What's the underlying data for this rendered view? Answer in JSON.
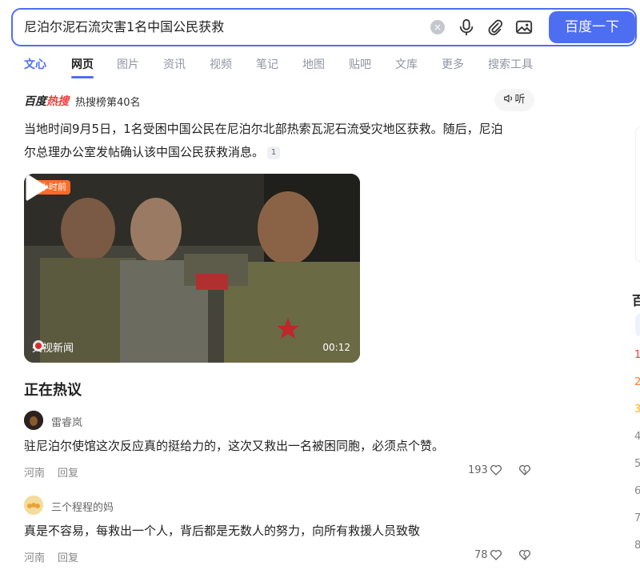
{
  "search": {
    "query": "尼泊尔泥石流灾害1名中国公民获救",
    "button_label": "百度一下",
    "clear_symbol": "×"
  },
  "tabs": [
    {
      "label": "文心"
    },
    {
      "label": "网页"
    },
    {
      "label": "图片"
    },
    {
      "label": "资讯"
    },
    {
      "label": "视频"
    },
    {
      "label": "笔记"
    },
    {
      "label": "地图"
    },
    {
      "label": "贴吧"
    },
    {
      "label": "文库"
    },
    {
      "label": "更多"
    },
    {
      "label": "搜索工具"
    }
  ],
  "hot": {
    "brand_black": "百度",
    "brand_red": "热搜",
    "rank_text": "热搜榜第40名",
    "listen_label": "听"
  },
  "summary": {
    "text": "当地时间9月5日，1名受困中国公民在尼泊尔北部热索瓦泥石流受灾地区获救。随后，尼泊尔总理办公室发帖确认该中国公民获救消息。",
    "citation": "1"
  },
  "video": {
    "time_badge": "4小时前",
    "source": "央视新闻",
    "duration": "00:12"
  },
  "discussion": {
    "title": "正在热议",
    "comments": [
      {
        "user": "雷睿岚",
        "text": "驻尼泊尔使馆这次反应真的挺给力的，这次又救出一名被困同胞，必须点个赞。",
        "location": "河南",
        "reply": "回复",
        "likes": "193"
      },
      {
        "user": "三个程程的妈",
        "text": "真是不容易，每救出一个人，背后都是无数人的努力，向所有救援人员致敬",
        "location": "河南",
        "reply": "回复",
        "likes": "78"
      }
    ]
  },
  "right_panel": {
    "title_fragment": "百",
    "numbers": [
      "1",
      "2",
      "3",
      "4",
      "5",
      "6",
      "7",
      "8"
    ],
    "number_colors": [
      "#f23c3c",
      "#ff7a2f",
      "#ffb21a",
      "#888888",
      "#888888",
      "#888888",
      "#888888",
      "#888888"
    ]
  },
  "colors": {
    "accent": "#4e6ef2",
    "hot_red": "#f23c3c",
    "badge_orange": "#ff6b2a"
  }
}
